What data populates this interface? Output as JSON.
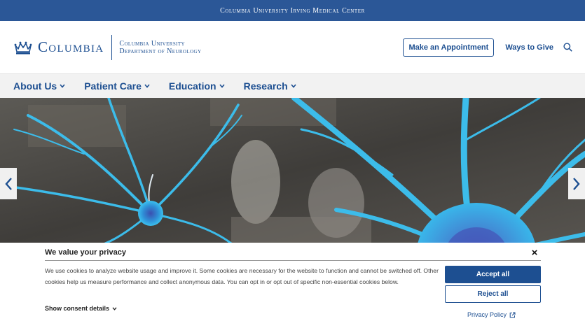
{
  "topbar": {
    "label": "Columbia University Irving Medical Center"
  },
  "header": {
    "brand_name": "Columbia",
    "dept_line1": "Columbia University",
    "dept_line2": "Department of Neurology",
    "appointment_label": "Make an Appointment",
    "give_label": "Ways to Give"
  },
  "nav": {
    "items": [
      {
        "label": "About Us"
      },
      {
        "label": "Patient Care"
      },
      {
        "label": "Education"
      },
      {
        "label": "Research"
      }
    ]
  },
  "icons": {
    "crown": "crown-logo-icon",
    "search": "search-icon",
    "chevron": "chevron-down-icon",
    "prev": "chevron-left-icon",
    "next": "chevron-right-icon",
    "close": "close-icon",
    "external": "external-link-icon"
  },
  "colors": {
    "brand_blue": "#1d4f91",
    "topbar_blue": "#2b5797",
    "nav_bg": "#f2f2f2",
    "neuron": "#34b3e6"
  },
  "cookie": {
    "title": "We value your privacy",
    "close": "×",
    "body": "We use cookies to analyze website usage and improve it. Some cookies are necessary for the website to function and cannot be switched off. Other cookies help us measure performance and collect anonymous data. You can opt in or opt out of specific non-essential cookies below.",
    "details_label": "Show consent details",
    "accept_label": "Accept all",
    "reject_label": "Reject all",
    "privacy_label": "Privacy Policy"
  }
}
